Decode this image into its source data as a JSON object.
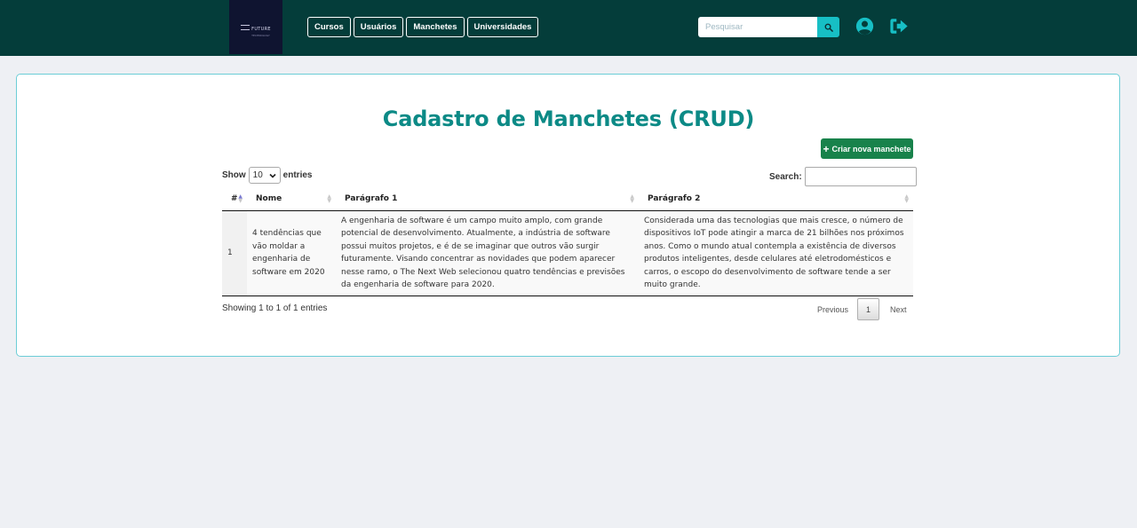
{
  "brand": {
    "logo_text": "FUTURE",
    "logo_subtext": "TECHNOLOGY"
  },
  "nav": {
    "items": [
      "Cursos",
      "Usuários",
      "Manchetes",
      "Universidades"
    ]
  },
  "search": {
    "placeholder": "Pesquisar",
    "value": ""
  },
  "icons": {
    "search": "search-icon",
    "user": "user-circle-icon",
    "logout": "sign-out-icon"
  },
  "colors": {
    "navbar": "#043d3a",
    "accent": "#17bfc5",
    "title": "#0c8a86",
    "create_button": "#18824b",
    "card_border": "#6ccdd6"
  },
  "page": {
    "title": "Cadastro de Manchetes (CRUD)",
    "create_button": "Criar nova manchete"
  },
  "table_controls": {
    "show_label": "Show",
    "entries_value": "10",
    "entries_label": "entries",
    "search_label": "Search:",
    "search_value": ""
  },
  "table": {
    "headers": [
      "#",
      "Nome",
      "Parágrafo 1",
      "Parágrafo 2"
    ],
    "rows": [
      {
        "id": "1",
        "nome": "4 tendências que vão moldar a engenharia de software em 2020",
        "paragrafo1": "A engenharia de software é um campo muito amplo, com grande potencial de desenvolvimento. Atualmente, a indústria de software possui muitos projetos, e é de se imaginar que outros vão surgir futuramente. Visando concentrar as novidades que podem aparecer nesse ramo, o The Next Web selecionou quatro tendências e previsões da engenharia de software para 2020.",
        "paragrafo2": "Considerada uma das tecnologias que mais cresce, o número de dispositivos IoT pode atingir a marca de 21 bilhões nos próximos anos. Como o mundo atual contempla a existência de diversos produtos inteligentes, desde celulares até eletrodomésticos e carros, o escopo do desenvolvimento de software tende a ser muito grande."
      }
    ]
  },
  "footer": {
    "info": "Showing 1 to 1 of 1 entries",
    "previous": "Previous",
    "current_page": "1",
    "next": "Next"
  }
}
